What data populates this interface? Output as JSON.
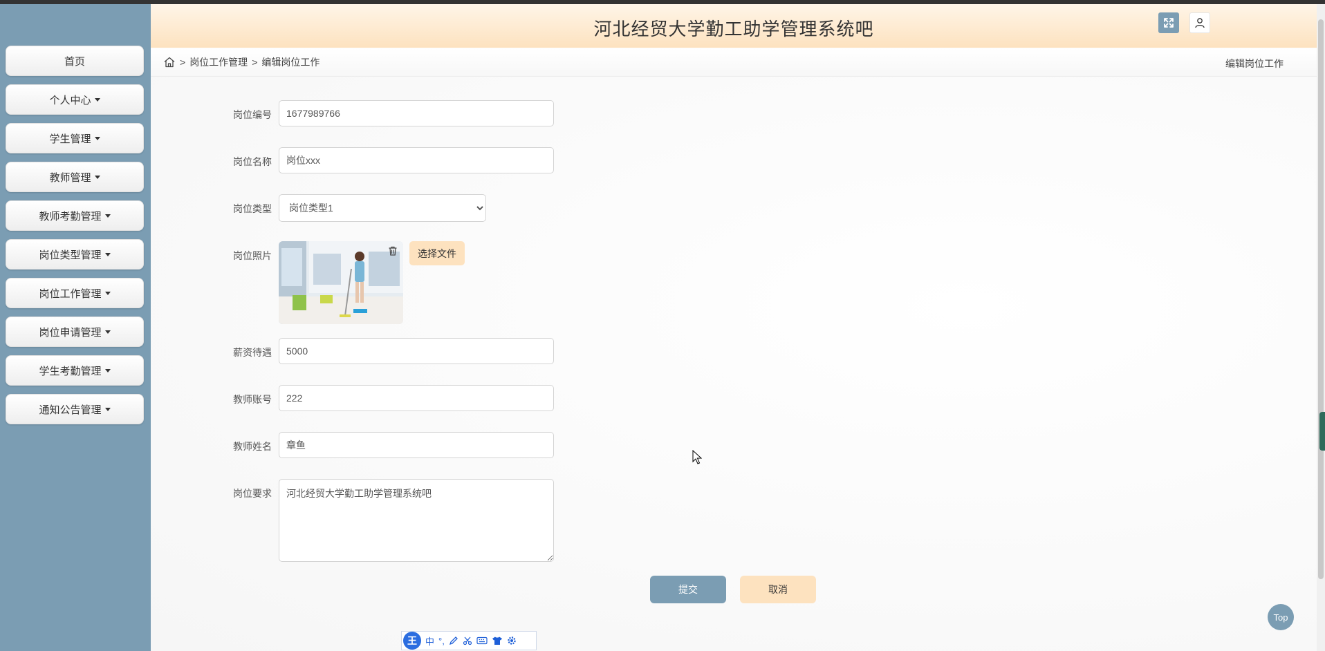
{
  "app": {
    "title": "河北经贸大学勤工助学管理系统吧"
  },
  "sidebar": {
    "items": [
      {
        "label": "首页",
        "has_caret": false
      },
      {
        "label": "个人中心",
        "has_caret": true
      },
      {
        "label": "学生管理",
        "has_caret": true
      },
      {
        "label": "教师管理",
        "has_caret": true
      },
      {
        "label": "教师考勤管理",
        "has_caret": true
      },
      {
        "label": "岗位类型管理",
        "has_caret": true
      },
      {
        "label": "岗位工作管理",
        "has_caret": true
      },
      {
        "label": "岗位申请管理",
        "has_caret": true
      },
      {
        "label": "学生考勤管理",
        "has_caret": true
      },
      {
        "label": "通知公告管理",
        "has_caret": true
      }
    ]
  },
  "breadcrumb": {
    "sep1": ">",
    "level1": "岗位工作管理",
    "sep2": ">",
    "level2": "编辑岗位工作",
    "page_title": "编辑岗位工作"
  },
  "form": {
    "code": {
      "label": "岗位编号",
      "value": "1677989766"
    },
    "name": {
      "label": "岗位名称",
      "value": "岗位xxx"
    },
    "type": {
      "label": "岗位类型",
      "value": "岗位类型1"
    },
    "photo": {
      "label": "岗位照片",
      "choose_label": "选择文件"
    },
    "salary": {
      "label": "薪资待遇",
      "value": "5000"
    },
    "teacher_account": {
      "label": "教师账号",
      "value": "222"
    },
    "teacher_name": {
      "label": "教师姓名",
      "value": "章鱼"
    },
    "requirement": {
      "label": "岗位要求",
      "value": "河北经贸大学勤工助学管理系统吧"
    }
  },
  "actions": {
    "submit": "提交",
    "cancel": "取消"
  },
  "top_button": "Top",
  "ime": {
    "logo": "王",
    "mode": "中",
    "punct": "°,"
  }
}
